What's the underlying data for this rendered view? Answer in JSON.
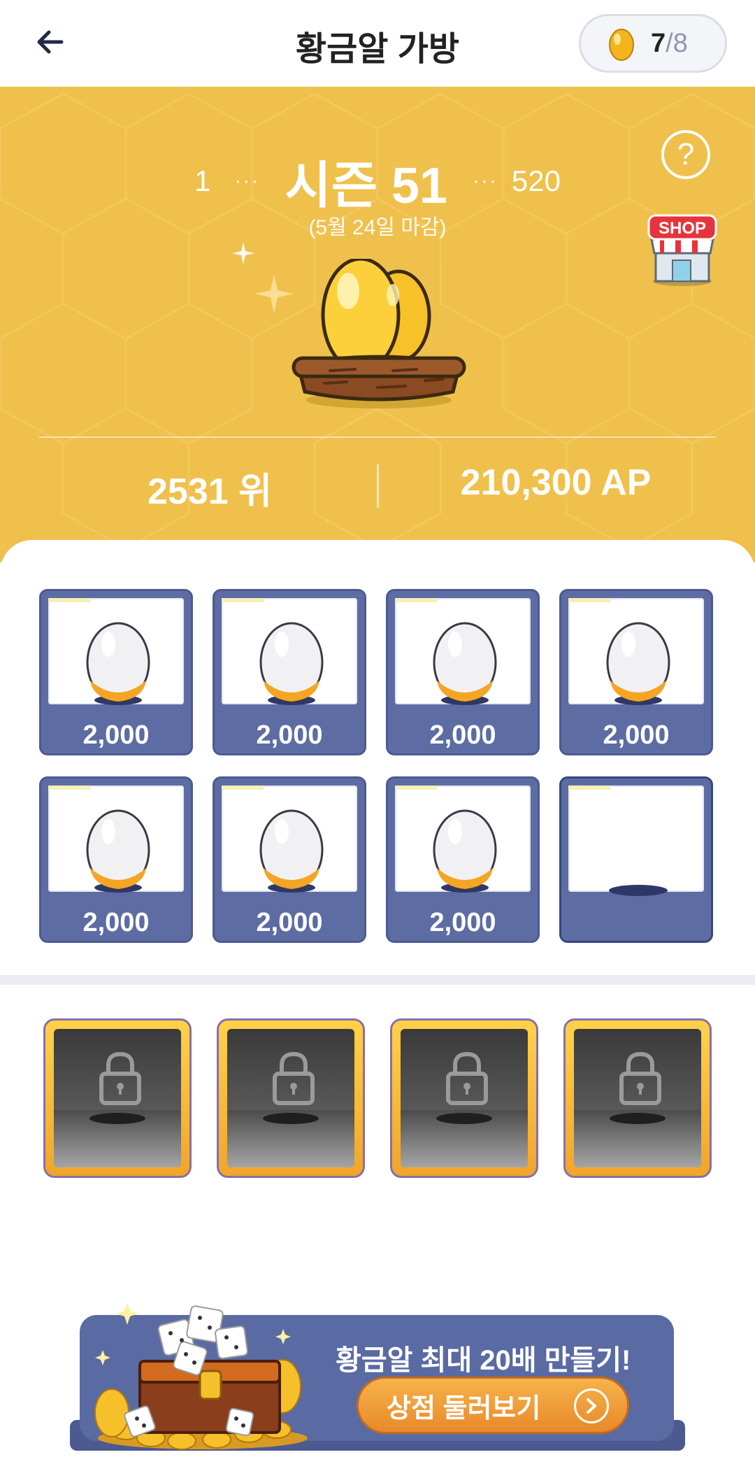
{
  "header": {
    "title": "황금알 가방",
    "egg_count": "7",
    "egg_separator": "/",
    "egg_max": "8"
  },
  "season": {
    "prev": "1",
    "title": "시즌 51",
    "next": "520",
    "dots": "···",
    "deadline": "(5월 24일 마감)",
    "help": "?",
    "shop_label": "SHOP",
    "rank": "2531 위",
    "ap": "210,300 AP"
  },
  "slots": [
    {
      "value": "2,000",
      "filled": true
    },
    {
      "value": "2,000",
      "filled": true
    },
    {
      "value": "2,000",
      "filled": true
    },
    {
      "value": "2,000",
      "filled": true
    },
    {
      "value": "2,000",
      "filled": true
    },
    {
      "value": "2,000",
      "filled": true
    },
    {
      "value": "2,000",
      "filled": true
    },
    {
      "value": "",
      "filled": false
    }
  ],
  "locked_slot_count": 4,
  "banner": {
    "title": "황금알 최대 20배 만들기!",
    "button": "상점 둘러보기"
  },
  "colors": {
    "season_bg": "#efc04c",
    "slot_blue": "#5e6ca4",
    "banner_bg": "#5a6aa3",
    "button_orange": "#e8892a"
  }
}
